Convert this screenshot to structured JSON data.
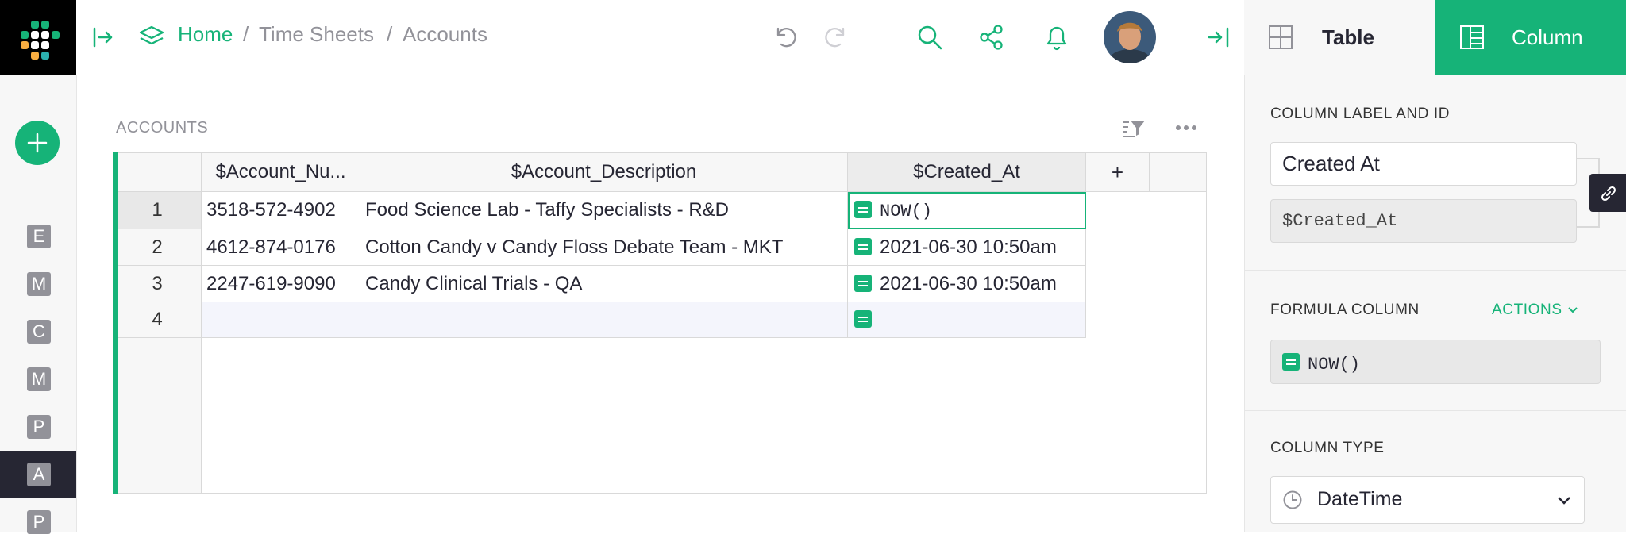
{
  "breadcrumb": {
    "home": "Home",
    "sep1": "/",
    "doc": "Time Sheets",
    "sep2": "/",
    "page": "Accounts"
  },
  "rail": {
    "pages": [
      "E",
      "M",
      "C",
      "M",
      "P",
      "A",
      "P"
    ],
    "active_index": 5
  },
  "section": {
    "title": "ACCOUNTS"
  },
  "grid": {
    "columns": [
      "$Account_Nu...",
      "$Account_Description",
      "$Created_At"
    ],
    "add_column": "+",
    "rows": [
      {
        "num": "1",
        "account": "3518-572-4902",
        "description": "Food Science Lab - Taffy Specialists - R&D",
        "created": "NOW()"
      },
      {
        "num": "2",
        "account": "4612-874-0176",
        "description": "Cotton Candy v Candy Floss Debate Team - MKT",
        "created": "2021-06-30 10:50am"
      },
      {
        "num": "3",
        "account": "2247-619-9090",
        "description": "Candy Clinical Trials - QA",
        "created": "2021-06-30 10:50am"
      },
      {
        "num": "4",
        "account": "",
        "description": "",
        "created": ""
      }
    ]
  },
  "panel": {
    "tab_table": "Table",
    "tab_column": "Column",
    "label_section": "COLUMN LABEL AND ID",
    "label_value": "Created At",
    "id_value": "$Created_At",
    "formula_section": "FORMULA COLUMN",
    "actions": "ACTIONS",
    "formula_value": "NOW()",
    "type_section": "COLUMN TYPE",
    "type_value": "DateTime"
  },
  "colors": {
    "accent": "#16b378",
    "dark": "#262633"
  }
}
